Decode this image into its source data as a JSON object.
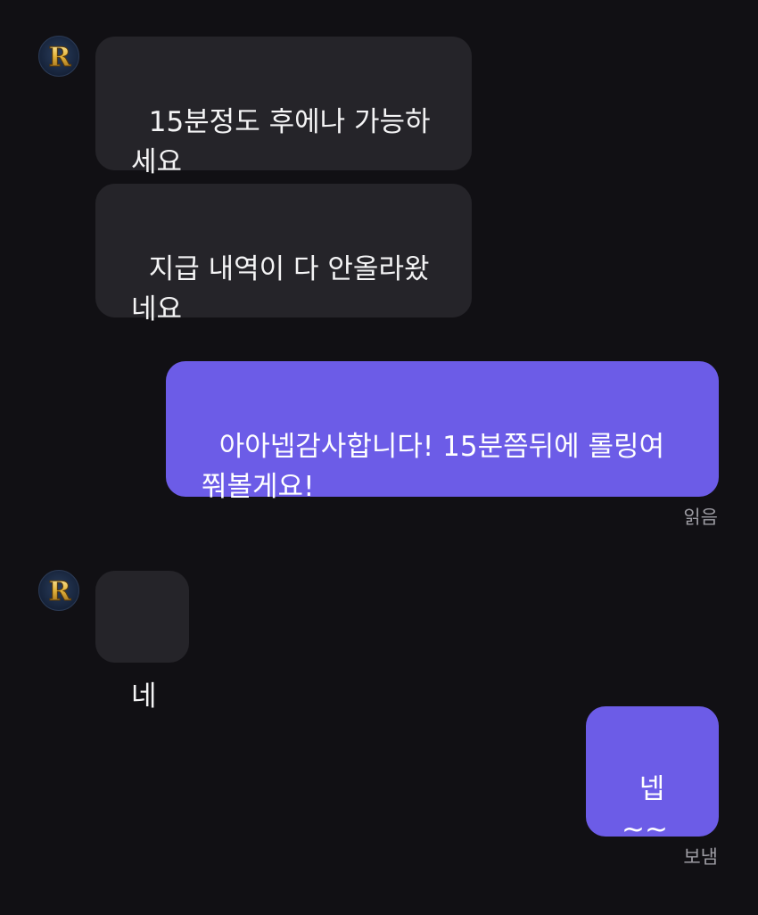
{
  "chat": {
    "messages": [
      {
        "sender": "other",
        "text": "15분정도 후에나 가능하\n세요"
      },
      {
        "sender": "other",
        "text": "지급 내역이 다 안올라왔\n네요"
      },
      {
        "sender": "me",
        "text": "아아넵감사합니다! 15분쯤뒤에 롤링여\n쭤볼게요!",
        "status": "읽음"
      },
      {
        "sender": "other",
        "text": "네"
      },
      {
        "sender": "me",
        "text": "넵\n~~",
        "status": "보냄"
      }
    ],
    "avatar": {
      "icon": "gold-r-logo-icon",
      "letter": "R"
    }
  },
  "colors": {
    "background": "#111014",
    "incoming_bubble": "#252429",
    "outgoing_bubble": "#6c5ce7",
    "status_text": "#9d9ca3"
  }
}
